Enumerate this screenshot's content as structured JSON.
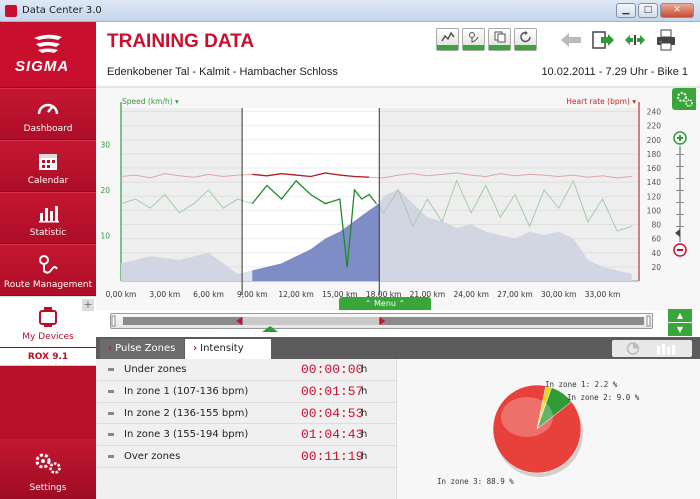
{
  "window": {
    "title": "Data Center 3.0",
    "minimize": "▁",
    "maximize": "□",
    "close": "✕"
  },
  "brand": {
    "logo_text": "SIGMA"
  },
  "sidebar": {
    "items": [
      {
        "label": "Dashboard",
        "icon": "speedometer-icon"
      },
      {
        "label": "Calendar",
        "icon": "calendar-icon"
      },
      {
        "label": "Statistic",
        "icon": "bar-chart-icon"
      },
      {
        "label": "Route Management",
        "icon": "route-pin-icon"
      },
      {
        "label": "My Devices",
        "icon": "watch-icon"
      }
    ],
    "device_add": "+",
    "device_name": "ROX 9.1",
    "settings_label": "Settings"
  },
  "header": {
    "title": "TRAINING DATA",
    "route": "Edenkobener Tal - Kalmit - Hambacher Schloss",
    "date_info": "10.02.2011 - 7.29 Uhr - Bike 1"
  },
  "toolbar": {
    "buttons": [
      "chart-view-icon",
      "map-view-icon",
      "copy-icon",
      "refresh-icon"
    ],
    "nav": [
      "back-arrow-icon",
      "export-icon",
      "expand-icon",
      "print-icon"
    ]
  },
  "chart_data": {
    "type": "line",
    "left_axis_label": "Speed (km/h)",
    "right_axis_label": "Heart rate (bpm)",
    "x_ticks": [
      "0,00 km",
      "3,00 km",
      "6,00 km",
      "9,00 km",
      "12,00 km",
      "15,00 km",
      "18,00 km",
      "21,00 km",
      "24,00 km",
      "27,00 km",
      "30,00 km",
      "33,00 km"
    ],
    "x_range": [
      0,
      35.5
    ],
    "y_left_ticks": [
      "10",
      "20",
      "30"
    ],
    "y_left_range": [
      0,
      38
    ],
    "y_right_ticks": [
      "20",
      "40",
      "60",
      "80",
      "100",
      "120",
      "140",
      "160",
      "180",
      "200",
      "220",
      "240"
    ],
    "y_right_range": [
      0,
      245
    ],
    "selection_km": [
      8.3,
      17.7
    ],
    "series": [
      {
        "name": "Speed (km/h)",
        "color": "#2e9b3a",
        "x": [
          0,
          1,
          2,
          3,
          4,
          5,
          6,
          7,
          8,
          9,
          10,
          11,
          12,
          13,
          14,
          15,
          15.5,
          16,
          16.5,
          17,
          17.5,
          18,
          19,
          20,
          21,
          22,
          23,
          24,
          25,
          26,
          27,
          28,
          29,
          30,
          31,
          32,
          33,
          34,
          35
        ],
        "values": [
          17,
          18,
          16,
          19,
          15,
          17,
          20,
          16,
          18,
          17,
          21,
          18,
          22,
          19,
          17,
          18,
          3,
          20,
          18,
          19,
          17,
          15,
          20,
          12,
          18,
          13,
          22,
          15,
          21,
          14,
          19,
          12,
          20,
          16,
          22,
          13,
          18,
          11,
          12
        ]
      },
      {
        "name": "Heart rate (bpm)",
        "color": "#c0282d",
        "x": [
          0,
          1,
          2,
          3,
          4,
          5,
          6,
          7,
          8,
          9,
          10,
          11,
          12,
          13,
          14,
          15,
          16,
          17,
          18,
          19,
          20,
          21,
          22,
          23,
          24,
          25,
          26,
          27,
          28,
          29,
          30,
          31,
          32,
          33,
          34,
          35
        ],
        "values": [
          148,
          150,
          146,
          152,
          149,
          147,
          151,
          148,
          150,
          151,
          149,
          152,
          150,
          148,
          153,
          150,
          148,
          147,
          146,
          150,
          152,
          149,
          151,
          153,
          150,
          148,
          152,
          149,
          151,
          150,
          148,
          150,
          147,
          149,
          146,
          148
        ]
      },
      {
        "name": "Altitude",
        "color": "#6f7fb8",
        "x": [
          0,
          2,
          4,
          6,
          8,
          9,
          10,
          11,
          12,
          13,
          14,
          15,
          16,
          17,
          17.7,
          18,
          19,
          20,
          21,
          22,
          23,
          24,
          25,
          26,
          27,
          28,
          29,
          30,
          31,
          32,
          33,
          34,
          35
        ],
        "values": [
          5,
          7,
          6,
          8,
          2,
          3,
          4,
          5,
          7,
          9,
          12,
          14,
          17,
          20,
          22,
          24,
          26,
          22,
          18,
          17,
          15,
          16,
          14,
          13,
          12,
          14,
          13,
          14,
          12,
          6,
          4,
          3,
          2
        ]
      }
    ]
  },
  "chart_ui": {
    "menu_label": "Menu"
  },
  "zones": {
    "tabs": [
      "Pulse Zones",
      "Intensity Zones"
    ],
    "rows": [
      {
        "name": "Under zones",
        "time": "00:00:00",
        "unit": "h"
      },
      {
        "name": "In zone 1 (107-136 bpm)",
        "time": "00:01:57",
        "unit": "h"
      },
      {
        "name": "In zone 2 (136-155 bpm)",
        "time": "00:04:53",
        "unit": "h"
      },
      {
        "name": "In zone 3 (155-194 bpm)",
        "time": "01:04:43",
        "unit": "h"
      },
      {
        "name": "Over zones",
        "time": "00:11:19",
        "unit": "h"
      }
    ],
    "pie": [
      {
        "label": "In zone 1: 2.2 %",
        "value": 2.2,
        "color": "#e6d620"
      },
      {
        "label": "In zone 2: 9.0 %",
        "value": 9.0,
        "color": "#2f9a36"
      },
      {
        "label": "In zone 3: 88.9 %",
        "value": 88.9,
        "color": "#e8403a"
      }
    ]
  }
}
